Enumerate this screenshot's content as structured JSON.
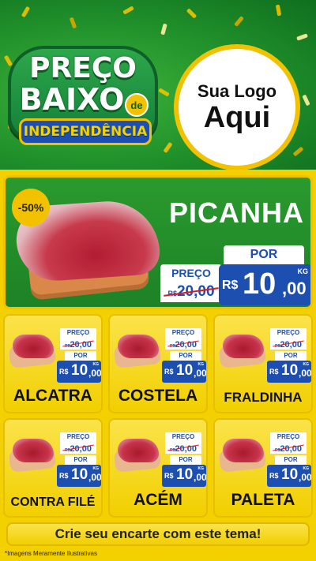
{
  "header": {
    "promo_line1": "PREÇO",
    "promo_line2": "BAIXO",
    "promo_de": "de",
    "promo_ribbon": "INDEPENDÊNCIA",
    "logo_line1": "Sua Logo",
    "logo_line2": "Aqui"
  },
  "hero": {
    "discount": "-50%",
    "title": "PICANHA",
    "por_label": "POR",
    "preco_label": "PREÇO",
    "old_currency": "R$",
    "old_value": "20,00",
    "currency": "R$",
    "price_int": "10",
    "price_cents": ",00",
    "unit": "KG"
  },
  "products": [
    {
      "name": "ALCATRA",
      "preco_label": "PREÇO",
      "old_currency": "R$",
      "old_value": "20,00",
      "por_label": "POR",
      "currency": "R$",
      "price_int": "10",
      "price_cents": ",00",
      "unit": "KG"
    },
    {
      "name": "COSTELA",
      "preco_label": "PREÇO",
      "old_currency": "R$",
      "old_value": "20,00",
      "por_label": "POR",
      "currency": "R$",
      "price_int": "10",
      "price_cents": ",00",
      "unit": "KG"
    },
    {
      "name": "FRALDINHA",
      "preco_label": "PREÇO",
      "old_currency": "R$",
      "old_value": "20,00",
      "por_label": "POR",
      "currency": "R$",
      "price_int": "10",
      "price_cents": ",00",
      "unit": "KG"
    },
    {
      "name": "CONTRA FILÉ",
      "preco_label": "PREÇO",
      "old_currency": "R$",
      "old_value": "20,00",
      "por_label": "POR",
      "currency": "R$",
      "price_int": "10",
      "price_cents": ",00",
      "unit": "KG"
    },
    {
      "name": "ACÉM",
      "preco_label": "PREÇO",
      "old_currency": "R$",
      "old_value": "20,00",
      "por_label": "POR",
      "currency": "R$",
      "price_int": "10",
      "price_cents": ",00",
      "unit": "KG"
    },
    {
      "name": "PALETA",
      "preco_label": "PREÇO",
      "old_currency": "R$",
      "old_value": "20,00",
      "por_label": "POR",
      "currency": "R$",
      "price_int": "10",
      "price_cents": ",00",
      "unit": "KG"
    }
  ],
  "footer": {
    "cta": "Crie seu encarte com este tema!",
    "disclaimer": "*Imagens Meramente Ilustrativas"
  },
  "colors": {
    "header_green": "#1f8f2a",
    "background_yellow": "#f3d000",
    "price_blue": "#1c4fb0",
    "strike_red": "#d51b2a"
  }
}
